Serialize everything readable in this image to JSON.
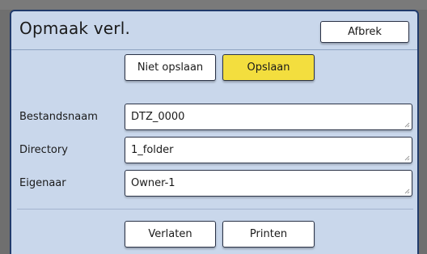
{
  "dialog": {
    "title": "Opmaak verl.",
    "cancel_label": "Afbrek"
  },
  "save_choice": {
    "no_save_label": "Niet opslaan",
    "save_label": "Opslaan",
    "selected": "Opslaan"
  },
  "fields": [
    {
      "label": "Bestandsnaam",
      "value": "DTZ_0000"
    },
    {
      "label": "Directory",
      "value": "1_folder"
    },
    {
      "label": "Eigenaar",
      "value": "Owner-1"
    }
  ],
  "footer": {
    "exit_label": "Verlaten",
    "print_label": "Printen"
  },
  "colors": {
    "dialog_bg": "#c9d7eb",
    "border": "#203a6b",
    "selected_button": "#f3de3e"
  }
}
